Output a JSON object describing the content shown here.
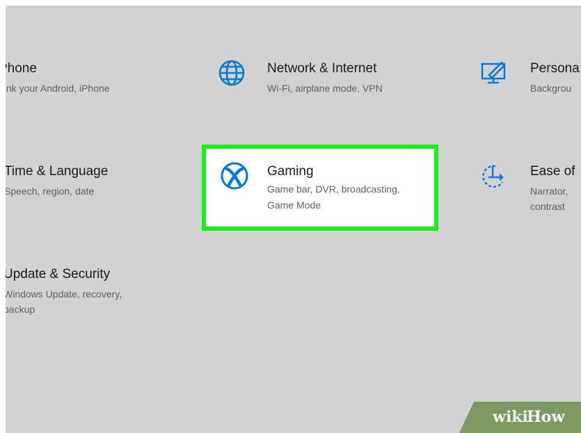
{
  "tiles": {
    "phone": {
      "title": "Phone",
      "desc": "Link your Android, iPhone"
    },
    "network": {
      "title": "Network & Internet",
      "desc": "Wi-Fi, airplane mode, VPN",
      "icon": "globe-icon"
    },
    "personalization": {
      "title": "Persona",
      "desc": "Backgrou",
      "icon": "personalization-icon"
    },
    "time": {
      "title": "Time & Language",
      "desc": "Speech, region, date"
    },
    "gaming": {
      "title": "Gaming",
      "desc_line1": "Game bar, DVR, broadcasting,",
      "desc_line2": "Game Mode",
      "icon": "xbox-icon"
    },
    "ease": {
      "title": "Ease of",
      "desc_line1": "Narrator,",
      "desc_line2": "contrast",
      "icon": "ease-of-access-icon"
    },
    "update": {
      "title": "Update & Security",
      "desc_line1": "Windows Update, recovery,",
      "desc_line2": "backup"
    }
  },
  "colors": {
    "background": "#d2d2d2",
    "accent": "#0078d7",
    "highlight": "#19f01b"
  },
  "watermark": {
    "part1": "wiki",
    "part2": "How"
  }
}
